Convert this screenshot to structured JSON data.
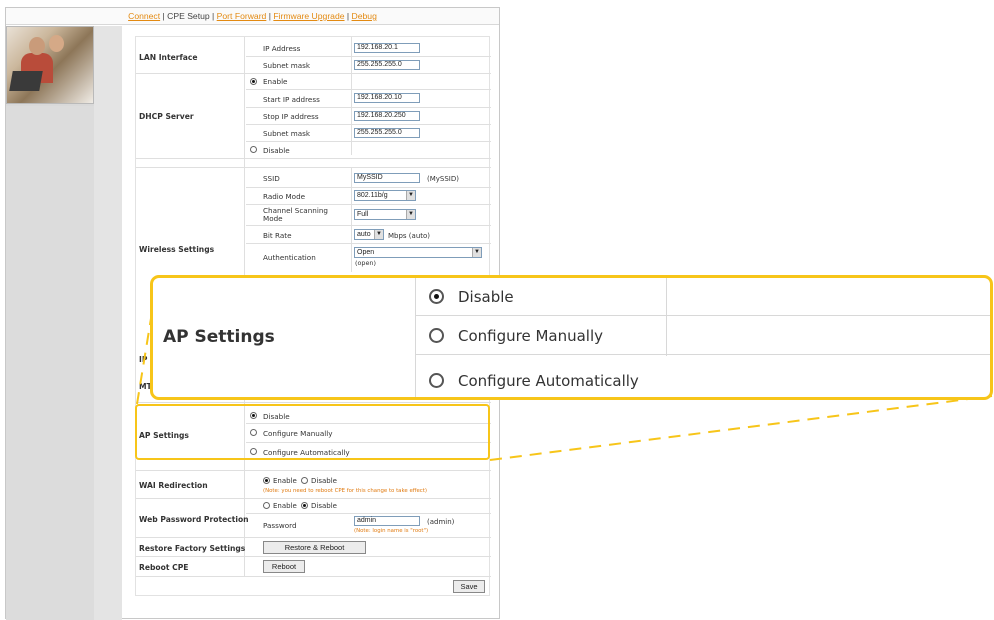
{
  "nav": {
    "connect": "Connect",
    "sep1": " | ",
    "cpe_setup": "CPE Setup",
    "sep2": " | ",
    "port_forward": "Port Forward",
    "sep3": " | ",
    "firmware_upgrade": "Firmware Upgrade",
    "sep4": " | ",
    "debug": "Debug"
  },
  "lan": {
    "section": "LAN Interface",
    "ip_label": "IP Address",
    "ip_value": "192.168.20.1",
    "mask_label": "Subnet mask",
    "mask_value": "255.255.255.0"
  },
  "dhcp": {
    "section": "DHCP Server",
    "enable": "Enable",
    "start_label": "Start IP address",
    "start_value": "192.168.20.10",
    "stop_label": "Stop IP address",
    "stop_value": "192.168.20.250",
    "mask_label": "Subnet mask",
    "mask_value": "255.255.255.0",
    "disable": "Disable"
  },
  "wireless": {
    "section": "Wireless Settings",
    "ssid_label": "SSID",
    "ssid_value": "MySSID",
    "ssid_hint": "(MySSID)",
    "radio_label": "Radio Mode",
    "radio_value": "802.11b/g",
    "channel_label": "Channel Scanning Mode",
    "channel_value": "Full",
    "bitrate_label": "Bit Rate",
    "bitrate_value": "auto",
    "bitrate_hint": "Mbps (auto)",
    "auth_label": "Authentication",
    "auth_value": "Open",
    "auth_hint": "(open)"
  },
  "partial": {
    "ip_label": "IP S",
    "mtu_label": "MTU"
  },
  "ap": {
    "section": "AP Settings",
    "disable": "Disable",
    "manual": "Configure Manually",
    "auto": "Configure Automatically"
  },
  "zoom": {
    "section": "AP Settings",
    "disable": "Disable",
    "manual": "Configure Manually",
    "auto": "Configure Automatically"
  },
  "wai": {
    "section": "WAI Redirection",
    "enable": "Enable",
    "disable": "Disable",
    "note": "(Note: you need to reboot CPE for this change to take effect)"
  },
  "webpw": {
    "section": "Web Password Protection",
    "enable": "Enable",
    "disable": "Disable",
    "pw_label": "Password",
    "pw_value": "admin",
    "pw_hint": "(admin)",
    "note": "(Note: login name is \"root\")"
  },
  "restore": {
    "section": "Restore Factory Settings",
    "button": "Restore & Reboot"
  },
  "reboot": {
    "section": "Reboot CPE",
    "button": "Reboot"
  },
  "save_button": "Save",
  "colors": {
    "highlight": "#f7c519",
    "link": "#e38a12",
    "note": "#e07a10"
  }
}
